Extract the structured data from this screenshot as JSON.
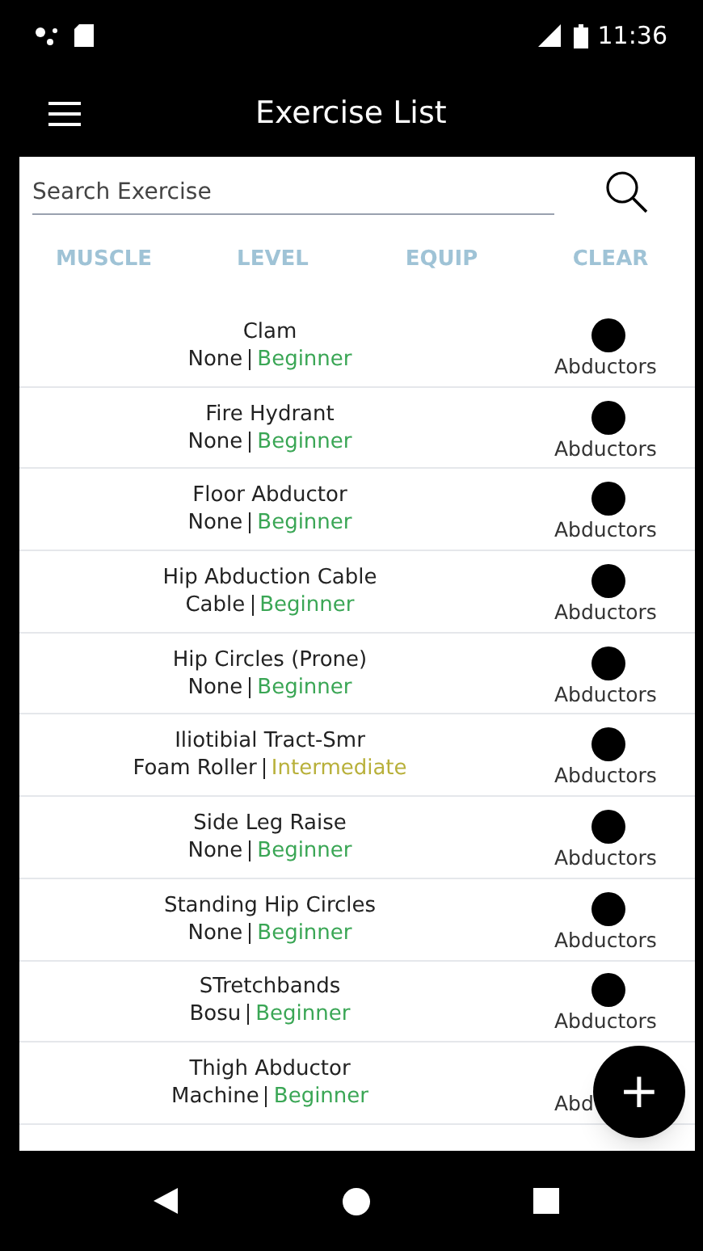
{
  "status_bar": {
    "time": "11:36"
  },
  "app_bar": {
    "title": "Exercise List"
  },
  "search": {
    "placeholder": "Search Exercise"
  },
  "filters": [
    {
      "label": "MUSCLE"
    },
    {
      "label": "LEVEL"
    },
    {
      "label": "EQUIP"
    },
    {
      "label": "CLEAR"
    }
  ],
  "exercises": [
    {
      "name": "Clam",
      "equipment": "None",
      "level": "Beginner",
      "color": "#3aa655",
      "muscle": "Abductors",
      "dot": true
    },
    {
      "name": "Fire Hydrant",
      "equipment": "None",
      "level": "Beginner",
      "color": "#3aa655",
      "muscle": "Abductors",
      "dot": true
    },
    {
      "name": "Floor Abductor",
      "equipment": "None",
      "level": "Beginner",
      "color": "#3aa655",
      "muscle": "Abductors",
      "dot": true
    },
    {
      "name": "Hip Abduction Cable",
      "equipment": "Cable",
      "level": "Beginner",
      "color": "#3aa655",
      "muscle": "Abductors",
      "dot": true
    },
    {
      "name": "Hip Circles (Prone)",
      "equipment": "None",
      "level": "Beginner",
      "color": "#3aa655",
      "muscle": "Abductors",
      "dot": true
    },
    {
      "name": "Iliotibial Tract-Smr",
      "equipment": "Foam Roller",
      "level": "Intermediate",
      "color": "#b8b03a",
      "muscle": "Abductors",
      "dot": true
    },
    {
      "name": "Side Leg Raise",
      "equipment": "None",
      "level": "Beginner",
      "color": "#3aa655",
      "muscle": "Abductors",
      "dot": true
    },
    {
      "name": "Standing Hip Circles",
      "equipment": "None",
      "level": "Beginner",
      "color": "#3aa655",
      "muscle": "Abductors",
      "dot": true
    },
    {
      "name": "STretchbands",
      "equipment": "Bosu",
      "level": "Beginner",
      "color": "#3aa655",
      "muscle": "Abductors",
      "dot": true
    },
    {
      "name": "Thigh Abductor",
      "equipment": "Machine",
      "level": "Beginner",
      "color": "#3aa655",
      "muscle": "Abd",
      "dot": false
    }
  ],
  "fab": {
    "label": "+"
  }
}
